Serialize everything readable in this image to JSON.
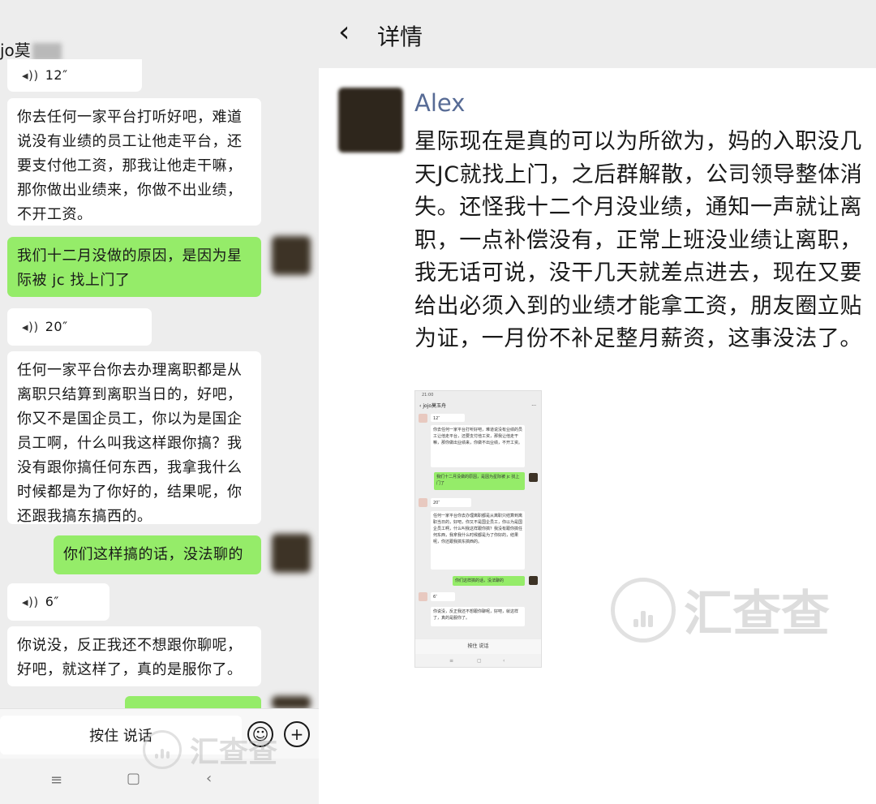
{
  "left_chat": {
    "contact_name": "jo莫",
    "messages": [
      {
        "type": "voice",
        "duration": "12″"
      },
      {
        "type": "text_in",
        "text": "你去任何一家平台打听好吧，难道说没有业绩的员工让他走平台，还要支付他工资，那我让他走干嘛，那你做出业绩来，你做不出业绩，不开工资。"
      },
      {
        "type": "text_out",
        "text": "我们十二月没做的原因，是因为星际被 jc 找上门了"
      },
      {
        "type": "voice",
        "duration": "20″"
      },
      {
        "type": "text_in",
        "text": "任何一家平台你去办理离职都是从离职只结算到离职当日的，好吧，你又不是国企员工，你以为是国企员工啊，什么叫我这样跟你搞？我没有跟你搞任何东西，我拿我什么时候都是为了你好的，结果呢，你还跟我搞东搞西的。"
      },
      {
        "type": "text_out",
        "text": "你们这样搞的话，没法聊的"
      },
      {
        "type": "voice",
        "duration": "6″"
      },
      {
        "type": "text_in",
        "text": "你说没，反正我还不想跟你聊呢，好吧，就这样了，真的是服你了。"
      }
    ],
    "input_bar": {
      "talk_label": "按住 说话",
      "emoji_icon": "emoji-icon",
      "plus_icon": "plus-icon"
    },
    "nav": {
      "menu_icon": "menu-icon",
      "home_icon": "home-icon",
      "back_icon": "back-icon"
    }
  },
  "detail": {
    "header": {
      "back_icon": "chevron-left-icon",
      "title": "详情"
    },
    "post": {
      "author": "Alex",
      "text": "星际现在是真的可以为所欲为，妈的入职没几天JC就找上门，之后群解散，公司领导整体消失。还怪我十二个月没业绩，通知一声就让离职，一点补偿没有，正常上班没业绩让离职，我无话可说，没干几天就差点进去，现在又要给出必须入到的业绩才能拿工资，朋友圈立贴为证，一月份不补足整月薪资，这事没法了。"
    },
    "screenshot": {
      "status_time": "21:00",
      "contact_name": "jojo莫玉舟",
      "messages": [
        "12″",
        "你去任何一家平台打听好吧，难道说没有业绩的员工让他走平台，还要支付他工资，那我让他走干嘛，那你做出业绩来，你做不出业绩，不开工资。",
        "我们十二月没做的原因，是因为星际被 jc 找上门了",
        "20″",
        "任何一家平台你去办理离职都是从离职只结算到离职当日的，好吧，你又不是国企员工，你以为是国企员工啊，什么叫我这样跟你搞？我没有跟你搞任何东西，我拿我什么时候都是为了你好的，结果呢，你还跟我搞东搞西的。",
        "你们这样搞的话，没法聊的",
        "6″",
        "你说没，反正我还不想跟你聊呢，好吧，就这样了，真的是服你了。"
      ],
      "talk_label": "按住 说话"
    }
  },
  "watermark": {
    "text": "汇查查"
  },
  "colors": {
    "incoming_bubble": "#ffffff",
    "outgoing_bubble": "#95ec69",
    "author_link": "#576b95",
    "chat_bg": "#ededed"
  }
}
